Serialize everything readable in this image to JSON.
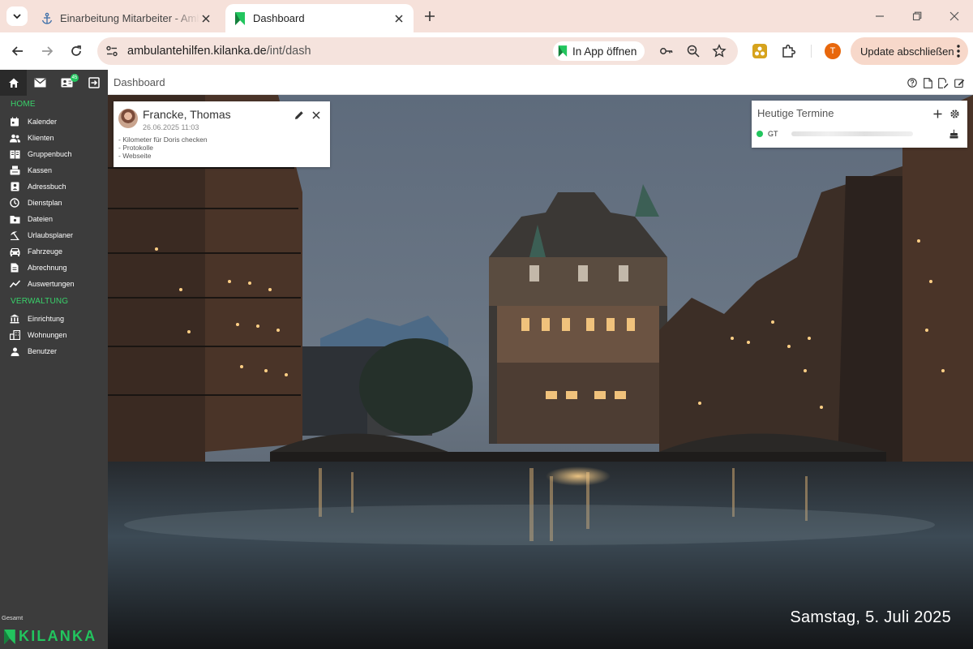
{
  "browser": {
    "tabs": [
      {
        "title": "Einarbeitung Mitarbeiter - Ambulante Hilfen",
        "active": false,
        "icon": "anchor-icon"
      },
      {
        "title": "Dashboard",
        "active": true,
        "icon": "kilanka-logo-icon"
      }
    ],
    "url_host": "ambulantehilfen.kilanka.de",
    "url_path": "/int/dash",
    "open_in_app_label": "In App öffnen",
    "profile_initial": "T",
    "update_label": "Update abschließen",
    "colors": {
      "tabstrip": "#f6e1da",
      "profile": "#e8670c",
      "update_button": "#f7d8ca"
    }
  },
  "app": {
    "breadcrumb": "Dashboard",
    "brand": "KILANKA",
    "brand_color": "#22c55e",
    "sidebar_bg": "#3c3c3c",
    "gesamt_label": "Gesamt",
    "top_icons": [
      {
        "name": "home-icon",
        "active": true
      },
      {
        "name": "mail-icon"
      },
      {
        "name": "contacts-icon",
        "badge": "45"
      },
      {
        "name": "logout-icon"
      }
    ],
    "sections": [
      {
        "title": "HOME",
        "items": [
          {
            "label": "Kalender",
            "icon": "calendar-icon"
          },
          {
            "label": "Klienten",
            "icon": "people-icon"
          },
          {
            "label": "Gruppenbuch",
            "icon": "book-icon"
          },
          {
            "label": "Kassen",
            "icon": "cashbox-icon"
          },
          {
            "label": "Adressbuch",
            "icon": "address-book-icon"
          },
          {
            "label": "Dienstplan",
            "icon": "clock-icon"
          },
          {
            "label": "Dateien",
            "icon": "folder-icon"
          },
          {
            "label": "Urlaubsplaner",
            "icon": "beach-icon"
          },
          {
            "label": "Fahrzeuge",
            "icon": "car-icon"
          },
          {
            "label": "Abrechnung",
            "icon": "invoice-icon"
          },
          {
            "label": "Auswertungen",
            "icon": "chart-line-icon"
          }
        ]
      },
      {
        "title": "VERWALTUNG",
        "items": [
          {
            "label": "Einrichtung",
            "icon": "institution-icon"
          },
          {
            "label": "Wohnungen",
            "icon": "apartment-icon"
          },
          {
            "label": "Benutzer",
            "icon": "user-icon"
          }
        ]
      }
    ],
    "header_icons": [
      "help-icon",
      "file-icon",
      "file-edit-icon",
      "note-edit-icon"
    ]
  },
  "note": {
    "name": "Francke, Thomas",
    "date": "26.06.2025 11:03",
    "lines": [
      "- Kilometer für Doris checken",
      "- Protokolle",
      "- Webseite"
    ]
  },
  "termine": {
    "title": "Heutige Termine",
    "rows": [
      {
        "code": "GT",
        "status_color": "#22c55e"
      }
    ]
  },
  "date_label": "Samstag, 5. Juli 2025"
}
